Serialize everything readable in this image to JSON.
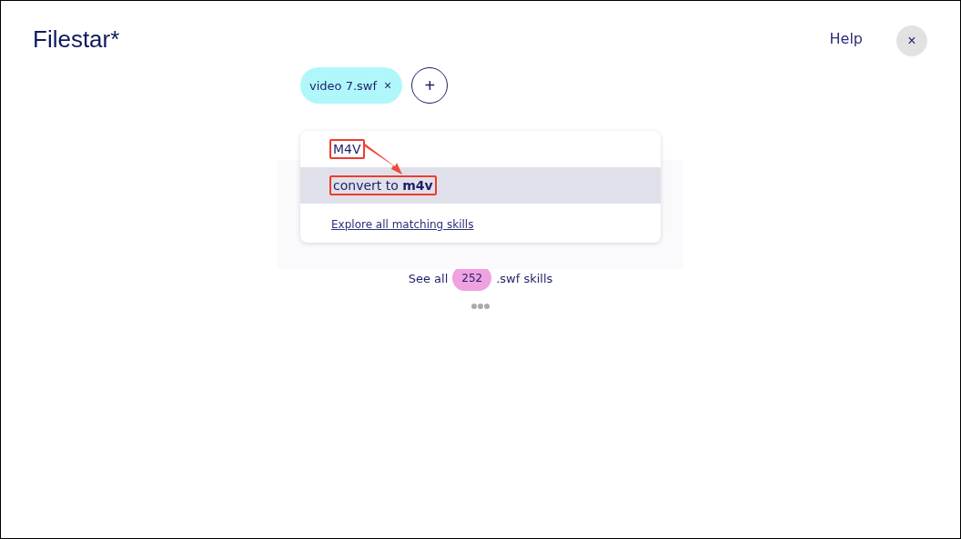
{
  "header": {
    "logo": "Filestar*",
    "help": "Help",
    "close": "×"
  },
  "files": [
    {
      "name": "video 7.swf",
      "remove": "×"
    }
  ],
  "add_button": "+",
  "dropdown": {
    "items": [
      {
        "label": "M4V",
        "selected": false,
        "annotated": true
      },
      {
        "label": "convert to **m4v**",
        "selected": true,
        "annotated": true
      }
    ],
    "link": "Explore all matching skills"
  },
  "see_all": {
    "prefix": "See all",
    "count": "252",
    "suffix": ".swf skills"
  }
}
